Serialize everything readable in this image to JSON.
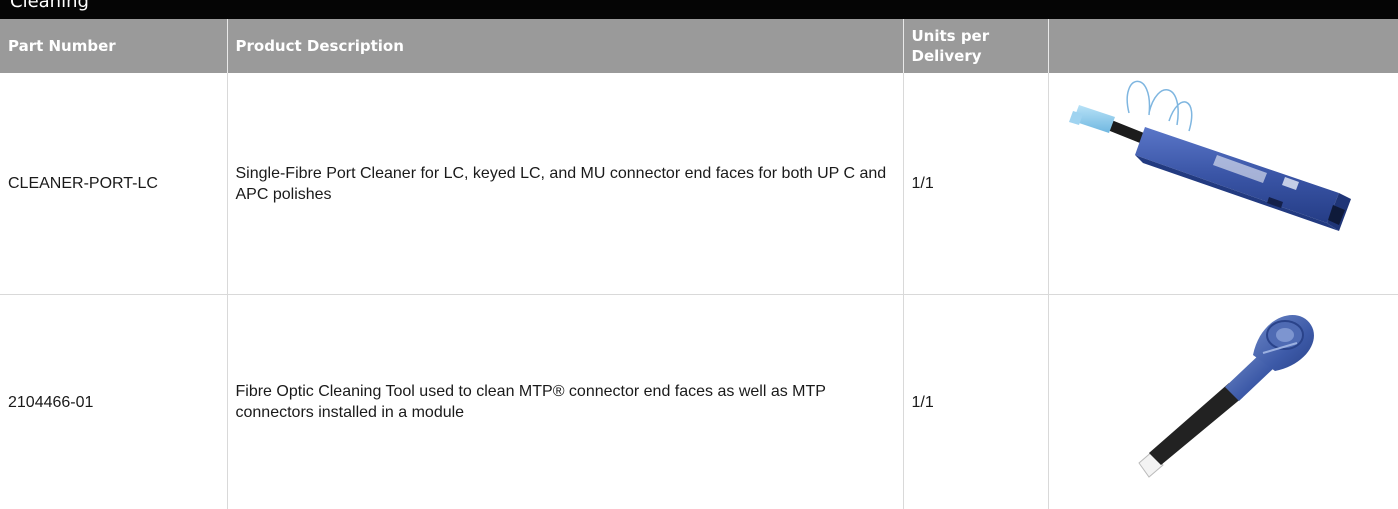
{
  "section_title": "Cleaning",
  "table": {
    "headers": {
      "part_number": "Part Number",
      "description": "Product Description",
      "units": "Units per Delivery",
      "image": ""
    },
    "rows": [
      {
        "part_number": "CLEANER-PORT-LC",
        "description": "Single-Fibre Port Cleaner for LC, keyed LC, and MU connector end faces for both UP C and APC polishes",
        "units": "1/1",
        "image_icon": "port-cleaner-pen-image"
      },
      {
        "part_number": "2104466-01",
        "description": "Fibre Optic Cleaning Tool used to clean MTP® connector end faces as well as MTP connectors installed in a module",
        "units": "1/1",
        "image_icon": "mtp-cleaning-tool-image"
      }
    ]
  },
  "colors": {
    "top_bar": "#050505",
    "header_bg": "#9a9a9a",
    "header_text": "#ffffff",
    "tool_blue": "#3b55a8"
  }
}
